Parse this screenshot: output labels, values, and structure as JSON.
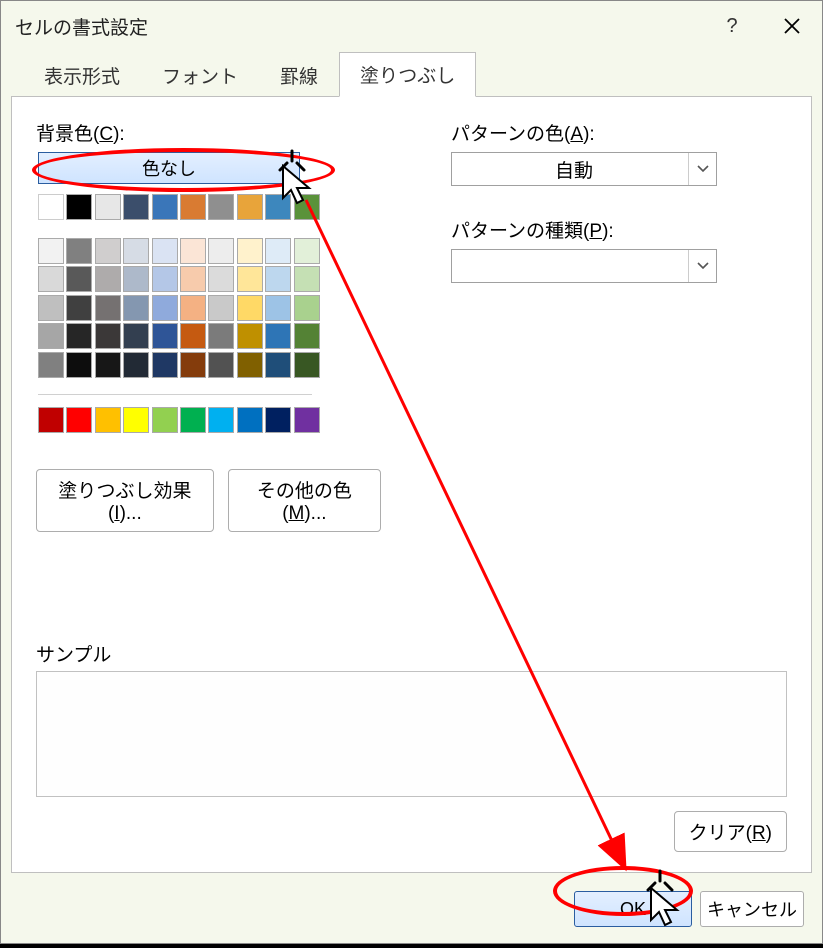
{
  "title": "セルの書式設定",
  "tabs": [
    {
      "label": "表示形式"
    },
    {
      "label": "フォント"
    },
    {
      "label": "罫線"
    },
    {
      "label": "塗りつぶし"
    }
  ],
  "activeTab": 3,
  "bgColorLabelPrefix": "背景色(",
  "bgColorLabelKey": "C",
  "bgColorLabelSuffix": "):",
  "noColorLabel": "色なし",
  "themeRow1": [
    "#ffffff",
    "#000000",
    "#e7e7e7",
    "#3b4e6b",
    "#3a76b9",
    "#d97b32",
    "#8f8f8f",
    "#e8a43a",
    "#3d87bd",
    "#5a923a"
  ],
  "themeGrid": [
    [
      "#f2f2f2",
      "#808080",
      "#d0cece",
      "#d6dce5",
      "#dae3f3",
      "#fbe5d6",
      "#ededed",
      "#fff2cc",
      "#deebf7",
      "#e2f0d9"
    ],
    [
      "#d9d9d9",
      "#595959",
      "#aeabab",
      "#adb9ca",
      "#b4c7e7",
      "#f7cbac",
      "#dbdbdb",
      "#ffe699",
      "#bdd7ee",
      "#c5e0b4"
    ],
    [
      "#bfbfbf",
      "#404040",
      "#757171",
      "#8497b0",
      "#8faadc",
      "#f4b183",
      "#c9c9c9",
      "#ffd966",
      "#9dc3e6",
      "#a9d18e"
    ],
    [
      "#a6a6a6",
      "#262626",
      "#3b3838",
      "#333f50",
      "#2f5597",
      "#c55a11",
      "#7b7b7b",
      "#bf9000",
      "#2e75b6",
      "#548235"
    ],
    [
      "#808080",
      "#0d0d0d",
      "#171717",
      "#222a35",
      "#1f3864",
      "#843c0c",
      "#525252",
      "#806000",
      "#1f4e79",
      "#385723"
    ]
  ],
  "standardColors": [
    "#c00000",
    "#ff0000",
    "#ffc000",
    "#ffff00",
    "#92d050",
    "#00b050",
    "#00b0f0",
    "#0070c0",
    "#002060",
    "#7030a0"
  ],
  "fillEffectsPrefix": "塗りつぶし効果(",
  "fillEffectsKey": "I",
  "fillEffectsSuffix": ")...",
  "moreColorsPrefix": "その他の色(",
  "moreColorsKey": "M",
  "moreColorsSuffix": ")...",
  "patternColorPrefix": "パターンの色(",
  "patternColorKey": "A",
  "patternColorSuffix": "):",
  "patternColorValue": "自動",
  "patternKindPrefix": "パターンの種類(",
  "patternKindKey": "P",
  "patternKindSuffix": "):",
  "patternKindValue": "",
  "sampleLabel": "サンプル",
  "clearPrefix": "クリア(",
  "clearKey": "R",
  "clearSuffix": ")",
  "okLabel": "OK",
  "cancelLabel": "キャンセル"
}
